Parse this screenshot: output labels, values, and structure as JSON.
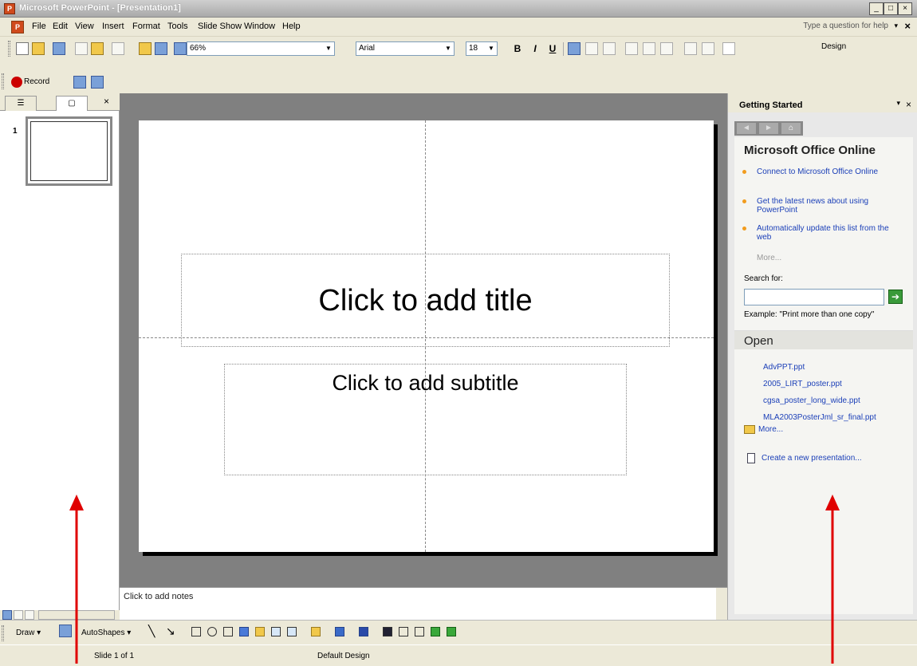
{
  "window": {
    "title": "Microsoft PowerPoint - [Presentation1]",
    "min": "_",
    "max": "□",
    "close": "×"
  },
  "menu": {
    "items": [
      "File",
      "Edit",
      "View",
      "Insert",
      "Format",
      "Tools",
      "Slide Show",
      "Window",
      "Help"
    ],
    "help_placeholder": "Type a question for help"
  },
  "toolbar": {
    "zoom": "66%",
    "font": "Arial",
    "size": "18",
    "bold": "B",
    "italic": "I",
    "underline": "U",
    "design": "Design"
  },
  "recordbar": {
    "record_label": "Record"
  },
  "outline": {
    "slide_number": "1"
  },
  "slide": {
    "title_placeholder": "Click to add title",
    "subtitle_placeholder": "Click to add subtitle"
  },
  "notes": {
    "placeholder": "Click to add notes"
  },
  "taskpane": {
    "title": "Getting Started",
    "office_heading": "Microsoft Office Online",
    "links": [
      "Connect to Microsoft Office Online",
      "Get the latest news about using PowerPoint",
      "Automatically update this list from the web"
    ],
    "more": "More...",
    "search_label": "Search for:",
    "example": "Example: \"Print more than one copy\"",
    "open_heading": "Open",
    "files": [
      "AdvPPT.ppt",
      "2005_LIRT_poster.ppt",
      "cgsa_poster_long_wide.ppt",
      "MLA2003PosterJml_sr_final.ppt"
    ],
    "open_more": "More...",
    "create_new": "Create a new presentation..."
  },
  "drawbar": {
    "draw": "Draw ▾",
    "autoshapes": "AutoShapes ▾"
  },
  "status": {
    "slide": "Slide 1 of 1",
    "design": "Default Design"
  },
  "colors": {
    "arrow": "#e00000",
    "link": "#1c40b8",
    "bullet": "#f29c1e"
  }
}
